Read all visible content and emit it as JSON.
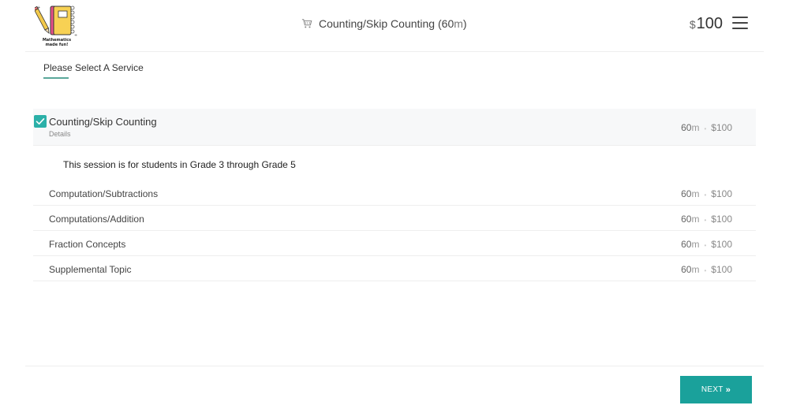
{
  "header": {
    "logo_caption_1": "Mathematics",
    "logo_caption_2": "made fun!",
    "cart_service": "Counting/Skip Counting",
    "cart_duration_open": " (",
    "cart_duration_value": "60",
    "cart_duration_unit": "m",
    "cart_duration_close": ")",
    "total_currency": "$",
    "total_amount": "100",
    "icons": {
      "cart": "cart-icon",
      "menu": "hamburger-menu-icon",
      "logo": "notebook-pencil-logo"
    }
  },
  "step": {
    "title": "Please Select A Service"
  },
  "selected_service": {
    "name": "Counting/Skip Counting",
    "details_label": "Details",
    "duration": "60",
    "duration_unit": "m",
    "currency": "$",
    "price": "100",
    "checked": true,
    "description": "This session is for students in Grade 3 through Grade 5"
  },
  "services": [
    {
      "name": "Computation/Subtractions",
      "duration": "60",
      "duration_unit": "m",
      "currency": "$",
      "price": "100"
    },
    {
      "name": "Computations/Addition",
      "duration": "60",
      "duration_unit": "m",
      "currency": "$",
      "price": "100"
    },
    {
      "name": "Fraction Concepts",
      "duration": "60",
      "duration_unit": "m",
      "currency": "$",
      "price": "100"
    },
    {
      "name": "Supplemental Topic",
      "duration": "60",
      "duration_unit": "m",
      "currency": "$",
      "price": "100"
    }
  ],
  "footer": {
    "next_label": "NEXT",
    "next_chevron": "»"
  },
  "colors": {
    "accent": "#1aa19b",
    "checkbox": "#2bb0a8",
    "underline": "#5aa79a"
  }
}
